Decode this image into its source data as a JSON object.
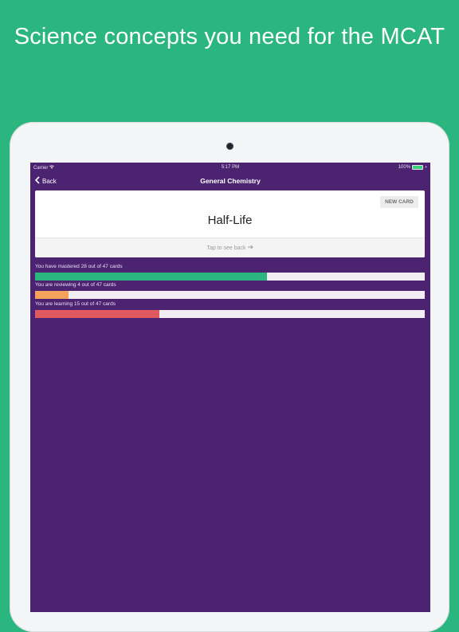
{
  "headline": "Science concepts you need for the MCAT",
  "status": {
    "carrier": "Carrier",
    "time": "5:17 PM",
    "battery": "100%"
  },
  "nav": {
    "back_label": "Back",
    "title": "General Chemistry"
  },
  "card": {
    "new_card_label": "NEW CARD",
    "term": "Half-Life",
    "hint": "Tap to see back"
  },
  "progress": [
    {
      "label": "You have mastered 28 out of 47 cards",
      "fraction": 0.5957,
      "color": "#2ab67e"
    },
    {
      "label": "You are reviewing 4 out of 47 cards",
      "fraction": 0.0851,
      "color": "#f5a25d"
    },
    {
      "label": "You are learning 15 out of 47 cards",
      "fraction": 0.3191,
      "color": "#e0595e"
    }
  ]
}
